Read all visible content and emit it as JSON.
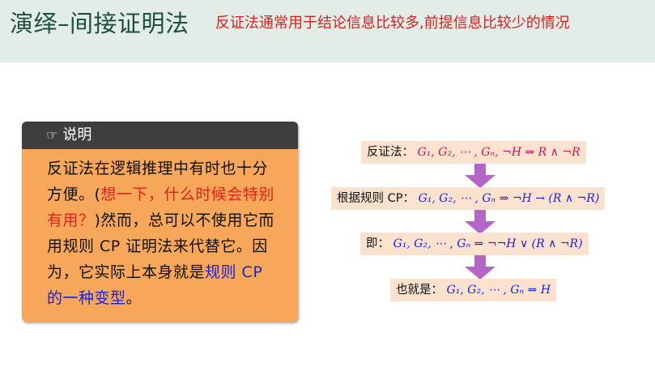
{
  "header": {
    "title": "演绎–间接证明法",
    "subtitle": "反证法通常用于结论信息比较多,前提信息比较少的情况"
  },
  "note": {
    "icon": "pointing-hand-icon",
    "title": "说明",
    "text_1": "反证法在逻辑推理中有时也十分方便。(",
    "text_red": "想一下，什么时候会特别有用？",
    "text_2": ")然而，总可以不使用它而用规则 CP 证明法来代替它。因为，它实际上本身就是",
    "text_blue": "规则 CP 的一种变型",
    "text_3": "。"
  },
  "flow": {
    "step1": {
      "label": "反证法：",
      "formula": "G₁, G₂, ⋯ , Gₙ, ¬H ⇒ R ∧ ¬R"
    },
    "step2": {
      "label": "根据规则 CP：",
      "formula": "G₁, G₂, ⋯ , Gₙ ⇒ ¬H → (R ∧ ¬R)"
    },
    "step3": {
      "label": "即：",
      "formula": "G₁, G₂, ⋯ , Gₙ ⇒ ¬¬H ∨ (R ∧ ¬R)"
    },
    "step4": {
      "label": "也就是：",
      "formula": "G₁, G₂, ⋯ , Gₙ ⇒ H"
    }
  },
  "colors": {
    "header_bg": "#e3ede8",
    "title": "#1e4f3a",
    "subtitle": "#d62020",
    "note_bg": "#f7a75a",
    "note_head": "#3e3e3e",
    "step_bg": "#fae2cf",
    "arrow": "#b366c6"
  }
}
